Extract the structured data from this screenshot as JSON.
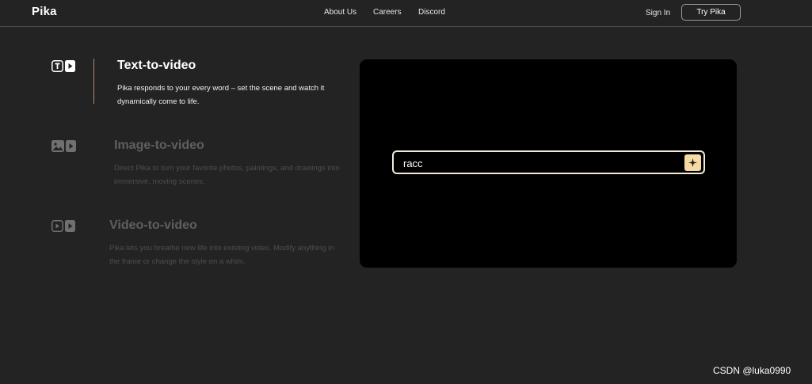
{
  "header": {
    "logo": "Pika",
    "nav": [
      "About Us",
      "Careers",
      "Discord"
    ],
    "sign_in": "Sign In",
    "cta": "Try Pika"
  },
  "features": [
    {
      "title": "Text-to-video",
      "description": "Pika responds to your every word – set the scene and watch it dynamically come to life.",
      "active": true,
      "icon": "text-play-icon"
    },
    {
      "title": "Image-to-video",
      "description": "Direct Pika to turn your favorite photos, paintings, and drawings into immersive, moving scenes.",
      "active": false,
      "icon": "image-play-icon"
    },
    {
      "title": "Video-to-video",
      "description": "Pika lets you breathe new life into existing video. Modify anything in the frame or change the style on a whim.",
      "active": false,
      "icon": "video-play-icon"
    }
  ],
  "prompt": {
    "value": "racc",
    "button_icon": "sparkle-icon"
  },
  "colors": {
    "background": "#232323",
    "panel": "#000000",
    "accent": "#f6d9a4",
    "active_bar": "#b08a6a"
  },
  "watermark": "CSDN @luka0990"
}
